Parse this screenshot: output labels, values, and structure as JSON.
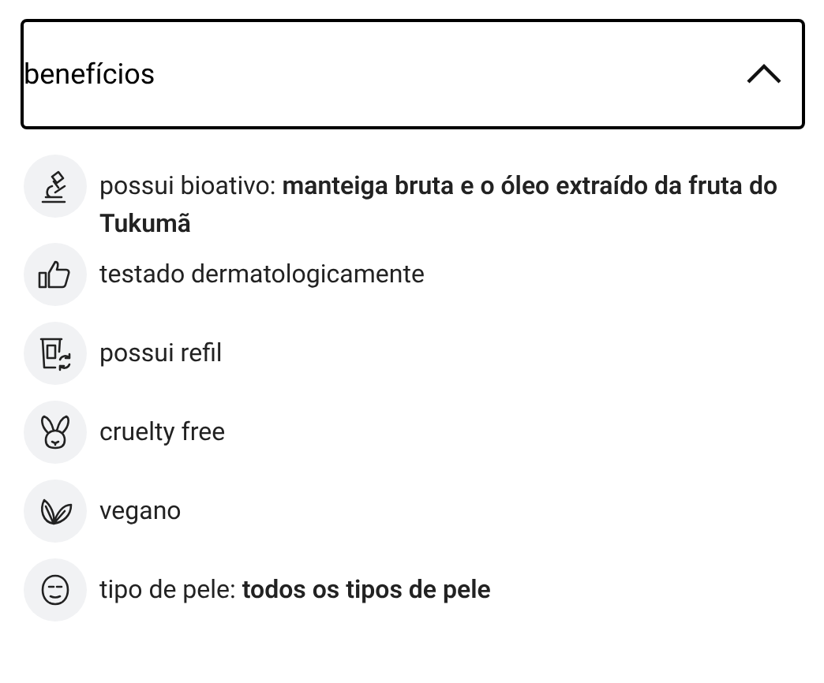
{
  "accordion": {
    "title": "benefícios",
    "expanded": true,
    "items": [
      {
        "kind": "microscope",
        "text": "possui bioativo: **manteiga bruta e o óleo extraído da fruta do Tukumã**"
      },
      {
        "kind": "thumbs-up",
        "text": "testado dermatologicamente"
      },
      {
        "kind": "refill",
        "text": "possui refil"
      },
      {
        "kind": "rabbit",
        "text": "cruelty free"
      },
      {
        "kind": "leaves",
        "text": "vegano"
      },
      {
        "kind": "face",
        "text": "tipo de pele: **todos os tipos de pele**"
      }
    ]
  }
}
